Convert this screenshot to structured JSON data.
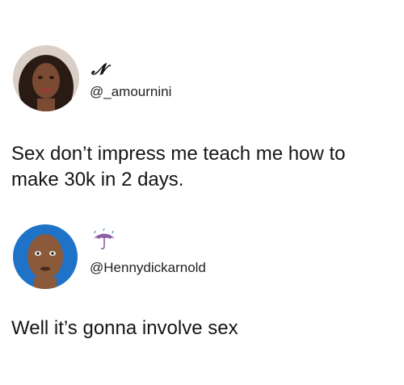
{
  "tweets": [
    {
      "display_name": "𝓝",
      "handle": "@_amournini",
      "text": "Sex don’t impress me teach me how to make 30k in 2 days."
    },
    {
      "display_name_icon": "umbrella-rain-icon",
      "handle": "@Hennydickarnold",
      "text": "Well it’s gonna involve sex"
    }
  ],
  "colors": {
    "background": "#ffffff",
    "text": "#151515",
    "umbrella": "#8a5fa6"
  }
}
